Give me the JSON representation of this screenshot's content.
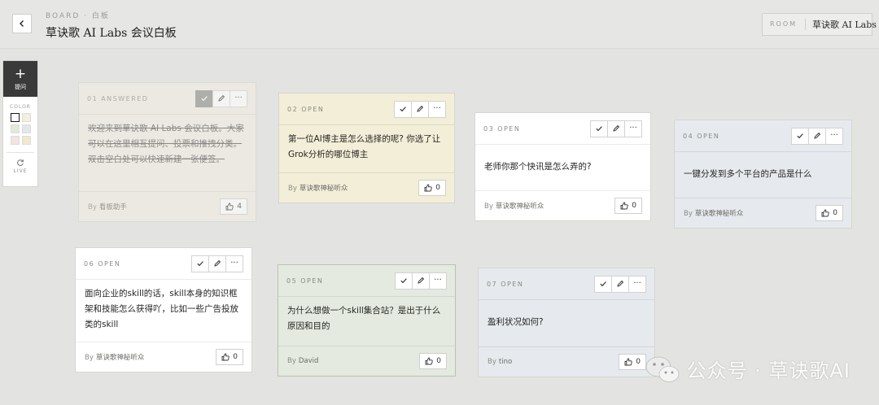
{
  "header": {
    "breadcrumb": "BOARD · 白板",
    "title": "草诀歌 AI Labs 会议白板",
    "room_label": "ROOM",
    "room_name": "草诀歌 AI Labs"
  },
  "toolbar": {
    "ask_label": "提问",
    "color_label": "COLOR",
    "live_label": "LIVE",
    "colors": [
      "#ffffff",
      "#f3efdf",
      "#e2e9dc",
      "#e3e7ec",
      "#f3e4e1",
      "#f1e8cf"
    ],
    "selected_color": "#ffffff"
  },
  "by_label": "By",
  "cards": [
    {
      "num": "01",
      "status": "ANSWERED",
      "text": "欢迎来到草诀歌 AI Labs 会议白板。大家可以在这里相互提问、投票和推拽分类。\n双击空白处可以快速新建一张便签。",
      "author": "看板助手",
      "likes": "4",
      "color": "#f1ede2"
    },
    {
      "num": "02",
      "status": "OPEN",
      "text": "第一位AI博主是怎么选择的呢? 你选了让Grok分析的哪位博主",
      "author": "草诀歌神秘听众",
      "likes": "0",
      "color": "#f3eed7"
    },
    {
      "num": "03",
      "status": "OPEN",
      "text": "老师你那个快讯是怎么弄的?",
      "author": "草诀歌神秘听众",
      "likes": "0",
      "color": "#ffffff"
    },
    {
      "num": "04",
      "status": "OPEN",
      "text": "一键分发到多个平台的产品是什么",
      "author": "草诀歌神秘听众",
      "likes": "0",
      "color": "#e6e9ed"
    },
    {
      "num": "06",
      "status": "OPEN",
      "text": "面向企业的skill的话，skill本身的知识框架和技能怎么获得吖，比如一些广告投放类的skill",
      "author": "草诀歌神秘听众",
      "likes": "0",
      "color": "#ffffff"
    },
    {
      "num": "05",
      "status": "OPEN",
      "text": "为什么想做一个skill集合站？是出于什么原因和目的",
      "author": "David",
      "likes": "0",
      "color": "#e4eadf"
    },
    {
      "num": "07",
      "status": "OPEN",
      "text": "盈利状况如何?",
      "author": "tino",
      "likes": "0",
      "color": "#e6e9ed"
    }
  ],
  "watermark": "公众号 · 草诀歌AI"
}
